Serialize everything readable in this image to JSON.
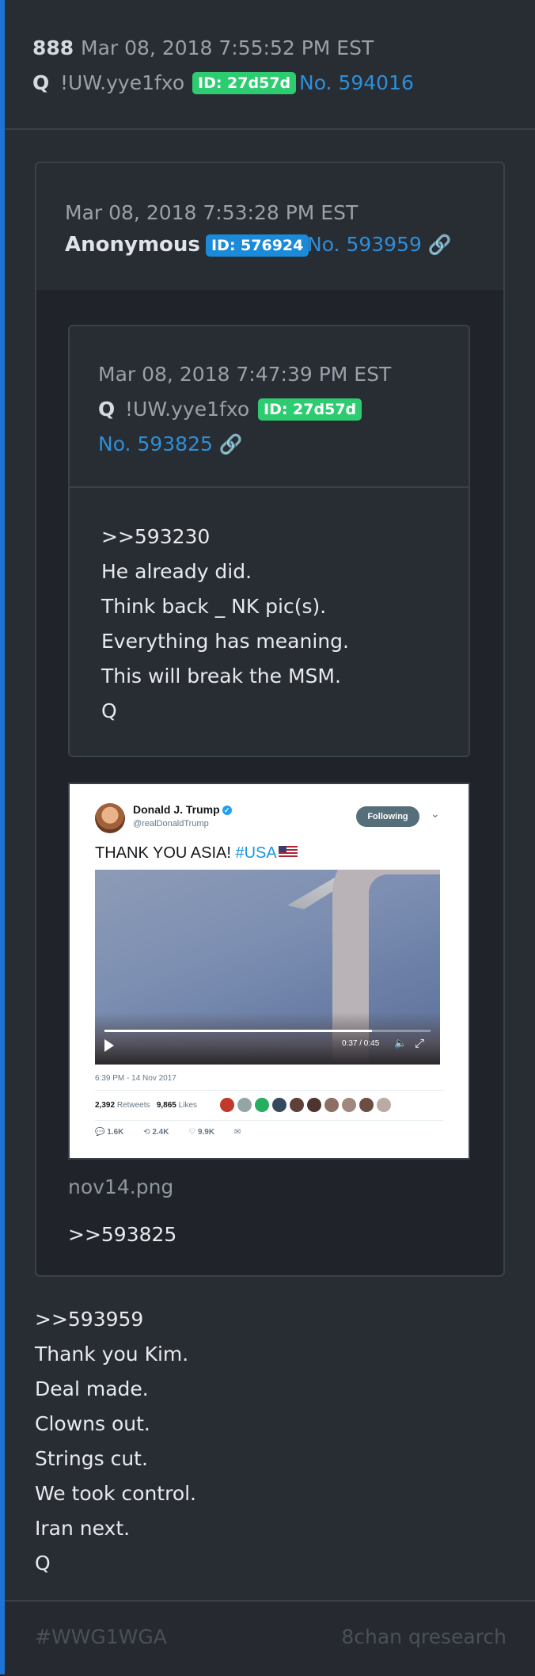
{
  "post": {
    "index": "888",
    "date": "Mar 08, 2018 7:55:52 PM EST",
    "author": "Q",
    "tripcode": "!UW.yye1fxo",
    "id_badge": "ID: 27d57d",
    "post_no": "No. 594016",
    "lines": [
      "&gt;&gt;593959",
      "Thank you Kim.",
      "Deal made.",
      "Clowns out.",
      "Strings cut.",
      "We took control.",
      "Iran next.",
      "Q"
    ]
  },
  "quoted": {
    "date": "Mar 08, 2018 7:53:28 PM EST",
    "author": "Anonymous",
    "id_badge": "ID: 576924",
    "post_no": "No. 593959",
    "nested": {
      "date": "Mar 08, 2018 7:47:39 PM EST",
      "author": "Q",
      "tripcode": "!UW.yye1fxo",
      "id_badge": "ID: 27d57d",
      "post_no": "No. 593825",
      "lines": [
        ">>593230",
        "He already did.",
        "Think back _ NK pic(s).",
        "Everything has meaning.",
        "This will break the MSM.",
        "Q"
      ]
    },
    "attachment": {
      "filename": "nov14.png",
      "tweet": {
        "name": "Donald J. Trump",
        "handle": "@realDonaldTrump",
        "follow_label": "Following",
        "text": "THANK YOU ASIA!",
        "hashtag": "#USA",
        "video_time": "0:37 / 0:45",
        "video_progress": 0.82,
        "timestamp": "6:39 PM - 14 Nov 2017",
        "retweets_count": "2,392",
        "retweets_label": "Retweets",
        "likes_count": "9,865",
        "likes_label": "Likes",
        "replies_action": "1.6K",
        "retweets_action": "2.4K",
        "likes_action": "9.9K",
        "face_colors": [
          "#c0392b",
          "#95a5a6",
          "#27ae60",
          "#34495e",
          "#5d4037",
          "#4e342e",
          "#8d6e63",
          "#a1887f",
          "#6d4c41",
          "#bcaaa4"
        ]
      }
    },
    "reply_line": ">>593825"
  },
  "footer": {
    "hashtag": "#WWG1WGA",
    "board": "8chan qresearch"
  },
  "colors": {
    "accent": "#1e74d6",
    "link": "#2d8fd9",
    "id_green": "#2ecc71",
    "id_blue": "#1b8ad8"
  },
  "icons": {
    "link": "link-icon"
  }
}
